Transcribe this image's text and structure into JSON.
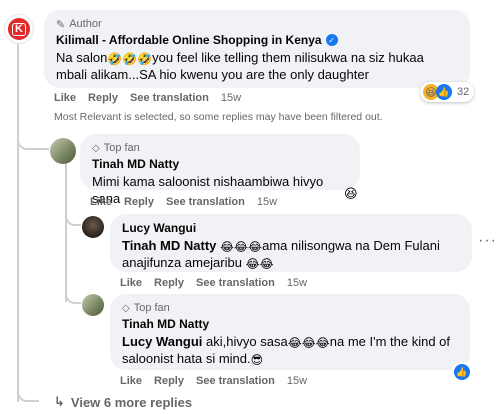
{
  "comment": {
    "badge": "Author",
    "author": "Kilimall - Affordable Online Shopping in Kenya",
    "text_a": "Na salon",
    "emoji_a": "🤣🤣🤣",
    "text_b": "you feel like telling them nilisukwa na siz hukaa",
    "text_c": "mbali alikam...SA hio kwenu you are the only daughter",
    "like": "Like",
    "reply": "Reply",
    "translate": "See translation",
    "time": "15w",
    "reaction_count": "32",
    "brand_color": "#e32a2a",
    "logo_letter": "K"
  },
  "filter_note": "Most Relevant is selected, so some replies may have been filtered out.",
  "reply1": {
    "badge": "Top fan",
    "author": "Tinah MD Natty",
    "text": "Mimi kama saloonist nishaambiwa hivyo sana",
    "reaction_emoji": "😆",
    "like": "Like",
    "reply": "Reply",
    "translate": "See translation",
    "time": "15w"
  },
  "reply2": {
    "author": "Lucy Wangui",
    "mention": "Tinah MD Natty",
    "emoji_a": "😂😂😂",
    "text_a": "ama nilisongwa na Dem Fulani",
    "text_b": "anajifunza amejaribu",
    "emoji_b": "😂😂",
    "like": "Like",
    "reply": "Reply",
    "translate": "See translation",
    "time": "15w",
    "menu": "···"
  },
  "reply3": {
    "badge": "Top fan",
    "author": "Tinah MD Natty",
    "mention": "Lucy Wangui",
    "text_a": "aki,hivyo sasa",
    "emoji_a": "😂😂😂",
    "text_b": "na me I'm the kind of",
    "text_c": "saloonist hata si mind.",
    "emoji_c": "😎",
    "like": "Like",
    "reply": "Reply",
    "translate": "See translation",
    "time": "15w"
  },
  "more_replies": "View 6 more replies"
}
